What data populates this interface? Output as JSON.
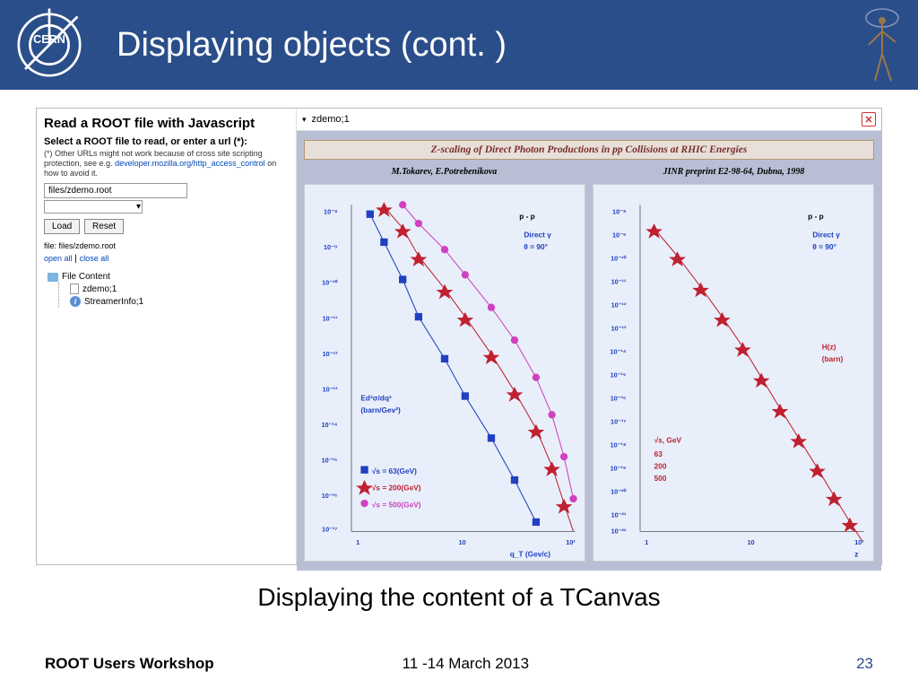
{
  "slide": {
    "title": "Displaying objects (cont. )",
    "caption": "Displaying the content of a TCanvas",
    "footer_left": "ROOT Users Workshop",
    "footer_mid": "11 -14 March 2013",
    "footer_right": "23"
  },
  "left_panel": {
    "heading": "Read a ROOT file with Javascript",
    "subheading": "Select a ROOT file to read, or enter a url (*):",
    "note_prefix": "(*) Other URLs might not work because of cross site scripting protection, see e.g. ",
    "note_link": "developer.mozilla.org/http_access_control",
    "note_suffix": " on how to avoid it.",
    "input_value": "files/zdemo.root",
    "btn_load": "Load",
    "btn_reset": "Reset",
    "file_label": "file: files/zdemo.root",
    "link_open": "open all",
    "link_close": "close all",
    "tree_root": "File Content",
    "tree_items": [
      "zdemo;1",
      "StreamerInfo;1"
    ]
  },
  "right_panel": {
    "tab_label": "zdemo;1",
    "canvas_title": "Z-scaling of Direct Photon Productions in pp Collisions at RHIC Energies",
    "author1": "M.Tokarev, E.Potrebenikova",
    "author2": "JINR preprint E2-98-64, Dubna, 1998",
    "plot1": {
      "pp": "p - p",
      "direct": "Direct γ",
      "theta": "θ = 90°",
      "ylabel1": "Ed³σ/dq³",
      "ylabel2": "(barn/Gev²)",
      "legend": [
        "√s = 63(GeV)",
        "√s = 200(GeV)",
        "√s = 500(GeV)"
      ],
      "xlabel": "q_T (Gev/c)"
    },
    "plot2": {
      "pp": "p - p",
      "direct": "Direct γ",
      "theta": "θ = 90°",
      "hz": "H(z)",
      "barn": "(barn)",
      "legend_title": "√s, GeV",
      "legend": [
        "63",
        "200",
        "500"
      ],
      "xlabel": "z"
    }
  },
  "chart_data": [
    {
      "type": "scatter",
      "title": "p-p Direct γ, θ=90°",
      "xlabel": "q_T (GeV/c)",
      "ylabel": "Ed³σ/dq³ (barn/GeV²)",
      "x_scale": "log",
      "y_scale": "log",
      "xlim": [
        1,
        120
      ],
      "ylim": [
        1e-17,
        1e-08
      ],
      "series": [
        {
          "name": "√s = 63 GeV",
          "marker": "square",
          "color": "#2040c0",
          "x": [
            1.5,
            2,
            3,
            4,
            6,
            8,
            12,
            18,
            25
          ],
          "y": [
            1e-08,
            3e-09,
            3e-10,
            5e-11,
            3e-12,
            4e-13,
            2e-14,
            8e-16,
            3e-17
          ]
        },
        {
          "name": "√s = 200 GeV",
          "marker": "star",
          "color": "#c02030",
          "x": [
            2,
            3,
            4,
            6,
            8,
            12,
            18,
            25,
            35,
            50,
            70
          ],
          "y": [
            3e-08,
            1e-08,
            3e-09,
            5e-10,
            1e-10,
            1e-11,
            1e-12,
            1e-13,
            8e-15,
            5e-16,
            3e-17
          ]
        },
        {
          "name": "√s = 500 GeV",
          "marker": "circle",
          "color": "#d040c0",
          "x": [
            3,
            4,
            6,
            8,
            12,
            18,
            25,
            35,
            50,
            70,
            100
          ],
          "y": [
            6e-08,
            3e-08,
            8e-09,
            2e-09,
            3e-10,
            4e-11,
            6e-12,
            6e-13,
            5e-14,
            3e-15,
            1e-16
          ]
        }
      ]
    },
    {
      "type": "scatter",
      "title": "p-p Direct γ, θ=90°, H(z)",
      "xlabel": "z",
      "ylabel": "H(z) (barn)",
      "x_scale": "log",
      "y_scale": "log",
      "xlim": [
        1,
        150
      ],
      "ylim": [
        1e-22,
        1e-08
      ],
      "series": [
        {
          "name": "63",
          "marker": "star",
          "color": "#c02030",
          "x": [
            1.3,
            2,
            3,
            4.5,
            7,
            10,
            15,
            22,
            33,
            50,
            75,
            110
          ],
          "y": [
            3e-09,
            2e-10,
            1e-11,
            8e-13,
            4e-14,
            2e-15,
            8e-17,
            3e-18,
            1e-19,
            4e-21,
            1e-22,
            2e-23
          ]
        }
      ]
    }
  ]
}
